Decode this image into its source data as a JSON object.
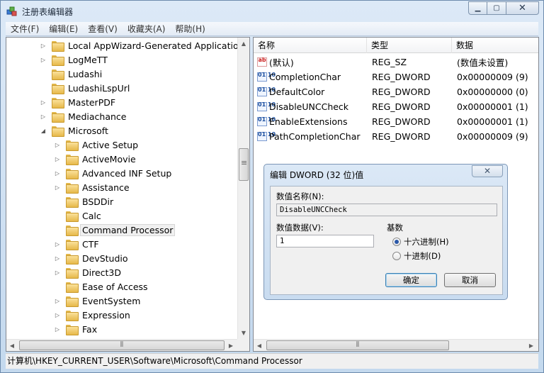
{
  "window": {
    "title": "注册表编辑器"
  },
  "menu": [
    "文件(F)",
    "编辑(E)",
    "查看(V)",
    "收藏夹(A)",
    "帮助(H)"
  ],
  "tree": [
    {
      "label": "Local AppWizard-Generated Applications",
      "level": 1,
      "expander": "▷"
    },
    {
      "label": "LogMeTT",
      "level": 1,
      "expander": "▷"
    },
    {
      "label": "Ludashi",
      "level": 1,
      "expander": ""
    },
    {
      "label": "LudashiLspUrl",
      "level": 1,
      "expander": ""
    },
    {
      "label": "MasterPDF",
      "level": 1,
      "expander": "▷"
    },
    {
      "label": "Mediachance",
      "level": 1,
      "expander": "▷"
    },
    {
      "label": "Microsoft",
      "level": 1,
      "expander": "◢"
    },
    {
      "label": "Active Setup",
      "level": 2,
      "expander": "▷"
    },
    {
      "label": "ActiveMovie",
      "level": 2,
      "expander": "▷"
    },
    {
      "label": "Advanced INF Setup",
      "level": 2,
      "expander": "▷"
    },
    {
      "label": "Assistance",
      "level": 2,
      "expander": "▷"
    },
    {
      "label": "BSDDir",
      "level": 2,
      "expander": ""
    },
    {
      "label": "Calc",
      "level": 2,
      "expander": ""
    },
    {
      "label": "Command Processor",
      "level": 2,
      "expander": "",
      "selected": true
    },
    {
      "label": "CTF",
      "level": 2,
      "expander": "▷"
    },
    {
      "label": "DevStudio",
      "level": 2,
      "expander": "▷"
    },
    {
      "label": "Direct3D",
      "level": 2,
      "expander": "▷"
    },
    {
      "label": "Ease of Access",
      "level": 2,
      "expander": ""
    },
    {
      "label": "EventSystem",
      "level": 2,
      "expander": "▷"
    },
    {
      "label": "Expression",
      "level": 2,
      "expander": "▷"
    },
    {
      "label": "Fax",
      "level": 2,
      "expander": "▷"
    }
  ],
  "list": {
    "headers": [
      "名称",
      "类型",
      "数据"
    ],
    "rows": [
      {
        "name": "(默认)",
        "type": "REG_SZ",
        "data": "(数值未设置)",
        "icon": "string-value-icon"
      },
      {
        "name": "CompletionChar",
        "type": "REG_DWORD",
        "data": "0x00000009 (9)",
        "icon": "binary-value-icon"
      },
      {
        "name": "DefaultColor",
        "type": "REG_DWORD",
        "data": "0x00000000 (0)",
        "icon": "binary-value-icon"
      },
      {
        "name": "DisableUNCCheck",
        "type": "REG_DWORD",
        "data": "0x00000001 (1)",
        "icon": "binary-value-icon"
      },
      {
        "name": "EnableExtensions",
        "type": "REG_DWORD",
        "data": "0x00000001 (1)",
        "icon": "binary-value-icon"
      },
      {
        "name": "PathCompletionChar",
        "type": "REG_DWORD",
        "data": "0x00000009 (9)",
        "icon": "binary-value-icon"
      }
    ]
  },
  "dialog": {
    "title": "编辑 DWORD (32 位)值",
    "name_label": "数值名称(N):",
    "name_value": "DisableUNCCheck",
    "data_label": "数值数据(V):",
    "data_value": "1",
    "base_label": "基数",
    "hex_label": "十六进制(H)",
    "dec_label": "十进制(D)",
    "base_selected": "hex",
    "ok_label": "确定",
    "cancel_label": "取消"
  },
  "status": {
    "path": "计算机\\HKEY_CURRENT_USER\\Software\\Microsoft\\Command Processor"
  }
}
